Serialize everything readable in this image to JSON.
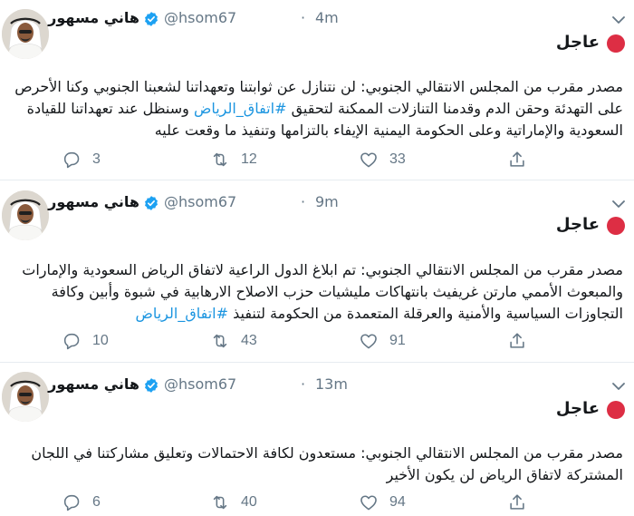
{
  "tweets": [
    {
      "author": "هاني مسهور",
      "handle": "@hsom67",
      "separator": "·",
      "time": "4m",
      "urgent_label": "عاجل",
      "lines": [
        {
          "text": "مصدر مقرب من المجلس الانتقالي الجنوبي: لن نتنازل عن ثوابتنا وتعهداتنا لشعبنا الجنوبي وكنا الأحرص"
        },
        {
          "pre": "على التهدئة وحقن الدم وقدمنا التنازلات الممكنة لتحقيق ",
          "hashtag": "#اتفاق_الرياض",
          "post": " وسنظل عند تعهداتنا للقيادة"
        },
        {
          "text": "السعودية والإماراتية وعلى الحكومة اليمنية الإيفاء بالتزامها وتنفيذ ما وقعت عليه"
        }
      ],
      "replies": "3",
      "retweets": "12",
      "likes": "33"
    },
    {
      "author": "هاني مسهور",
      "handle": "@hsom67",
      "separator": "·",
      "time": "9m",
      "urgent_label": "عاجل",
      "lines": [
        {
          "text": "مصدر مقرب من المجلس الانتقالي الجنوبي: تم ابلاغ الدول الراعية لاتفاق الرياض السعودية والإمارات"
        },
        {
          "text": "والمبعوث الأممي مارتن غريفيث بانتهاكات مليشيات حزب الاصلاح الارهابية في شبوة وأبين وكافة"
        },
        {
          "pre": "التجاوزات السياسية والأمنية والعرقلة المتعمدة من الحكومة لتنفيذ ",
          "hashtag": "#اتفاق_الرياض",
          "post": ""
        }
      ],
      "replies": "10",
      "retweets": "43",
      "likes": "91"
    },
    {
      "author": "هاني مسهور",
      "handle": "@hsom67",
      "separator": "·",
      "time": "13m",
      "urgent_label": "عاجل",
      "lines": [
        {
          "text": "مصدر مقرب من المجلس الانتقالي الجنوبي: مستعدون لكافة الاحتمالات وتعليق مشاركتنا في اللجان"
        },
        {
          "text": "المشتركة لاتفاق الرياض لن يكون الأخير"
        }
      ],
      "replies": "6",
      "retweets": "40",
      "likes": "94"
    }
  ],
  "colors": {
    "verified": "#1da1f2",
    "hashtag": "#1b95e0",
    "muted": "#657786",
    "urgent_circle": "#dd2e44",
    "divider": "#e6ecf0"
  },
  "icons": {
    "verified": "verified-badge-icon",
    "reply": "reply-icon",
    "retweet": "retweet-icon",
    "like": "heart-icon",
    "share": "share-icon",
    "caret": "chevron-down-icon",
    "urgent": "red-circle-icon"
  }
}
